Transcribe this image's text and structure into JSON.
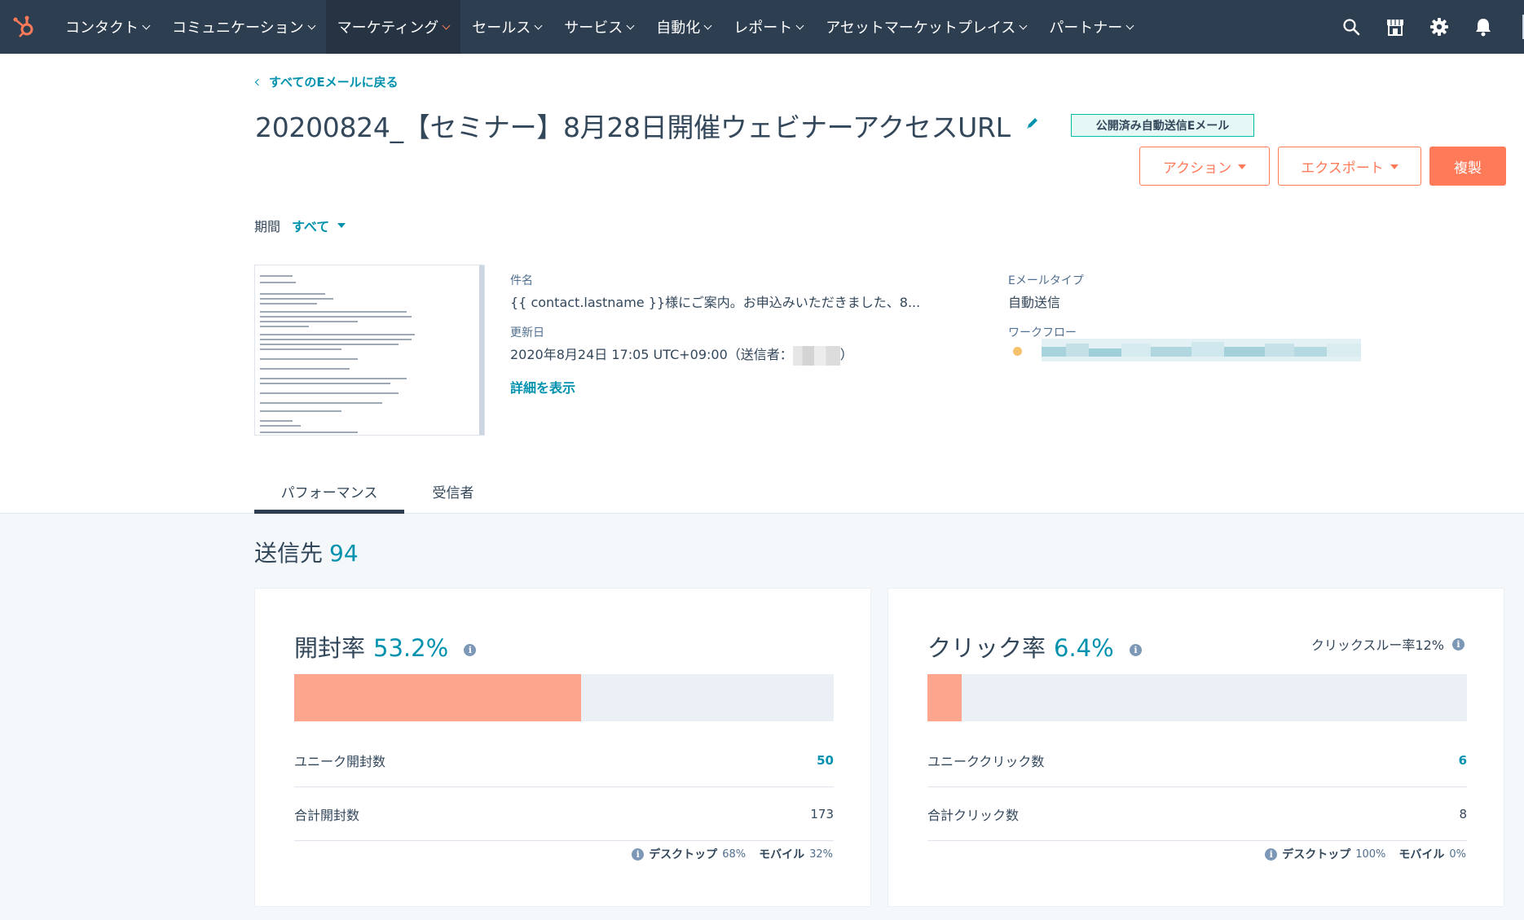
{
  "nav": {
    "items": [
      {
        "label": "コンタクト",
        "active": false
      },
      {
        "label": "コミュニケーション",
        "active": false
      },
      {
        "label": "マーケティング",
        "active": true
      },
      {
        "label": "セールス",
        "active": false
      },
      {
        "label": "サービス",
        "active": false
      },
      {
        "label": "自動化",
        "active": false
      },
      {
        "label": "レポート",
        "active": false
      },
      {
        "label": "アセットマーケットプレイス",
        "active": false
      },
      {
        "label": "パートナー",
        "active": false
      }
    ],
    "icons": [
      "search-icon",
      "marketplace-icon",
      "settings-icon",
      "notifications-icon"
    ]
  },
  "header": {
    "back_link": "すべてのEメールに戻る",
    "title": "20200824_【セミナー】8月28日開催ウェビナーアクセスURL",
    "status_badge": "公開済み自動送信Eメール",
    "buttons": {
      "actions": "アクション",
      "export": "エクスポート",
      "clone": "複製"
    }
  },
  "period": {
    "label": "期間",
    "value": "すべて"
  },
  "details": {
    "subject_label": "件名",
    "subject_value": "{{ contact.lastname }}様にご案内。お申込みいただきました、8...",
    "updated_label": "更新日",
    "updated_value_prefix": "2020年8月24日 17:05 UTC+09:00（送信者：",
    "updated_value_suffix": "）",
    "view_details": "詳細を表示",
    "email_type_label": "Eメールタイプ",
    "email_type_value": "自動送信",
    "workflow_label": "ワークフロー"
  },
  "tabs": [
    {
      "label": "パフォーマンス",
      "active": true
    },
    {
      "label": "受信者",
      "active": false
    }
  ],
  "sent": {
    "label": "送信先",
    "value": "94"
  },
  "open_card": {
    "title": "開封率",
    "rate": "53.2%",
    "rate_fraction": 0.532,
    "rows": [
      {
        "label": "ユニーク開封数",
        "value": "50"
      },
      {
        "label": "合計開封数",
        "value": "173"
      }
    ],
    "desktop_label": "デスクトップ",
    "desktop_value": "68%",
    "mobile_label": "モバイル",
    "mobile_value": "32%"
  },
  "click_card": {
    "title": "クリック率",
    "rate": "6.4%",
    "rate_fraction": 0.064,
    "ctr": "クリックスルー率12%",
    "rows": [
      {
        "label": "ユニーククリック数",
        "value": "6"
      },
      {
        "label": "合計クリック数",
        "value": "8"
      }
    ],
    "desktop_label": "デスクトップ",
    "desktop_value": "100%",
    "mobile_label": "モバイル",
    "mobile_value": "0%"
  },
  "colors": {
    "nav_bg": "#2d3e50",
    "accent": "#ff7a59",
    "link": "#0091ae",
    "bar_fill": "#fea58e",
    "bar_track": "#eaf0f6"
  }
}
